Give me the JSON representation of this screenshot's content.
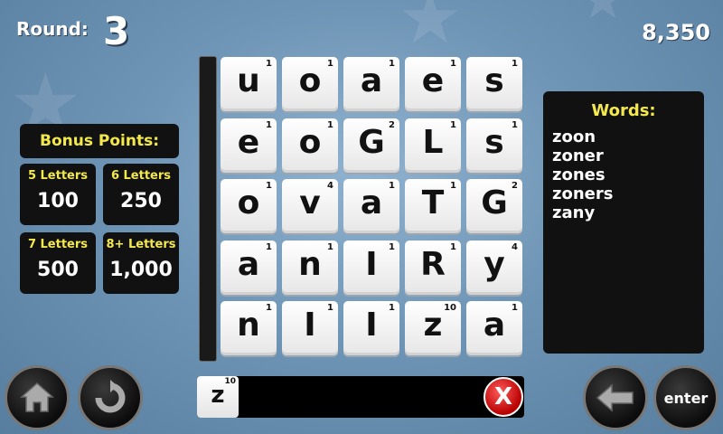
{
  "header": {
    "round_label": "Round:",
    "round_number": "3",
    "score": "8,350"
  },
  "bonus": {
    "title": "Bonus Points:",
    "tiers": [
      {
        "label": "5 Letters",
        "value": "100"
      },
      {
        "label": "6 Letters",
        "value": "250"
      },
      {
        "label": "7 Letters",
        "value": "500"
      },
      {
        "label": "8+ Letters",
        "value": "1,000"
      }
    ]
  },
  "board": {
    "rows": [
      [
        {
          "letter": "u",
          "points": "1"
        },
        {
          "letter": "o",
          "points": "1"
        },
        {
          "letter": "a",
          "points": "1"
        },
        {
          "letter": "e",
          "points": "1"
        },
        {
          "letter": "s",
          "points": "1"
        }
      ],
      [
        {
          "letter": "e",
          "points": "1"
        },
        {
          "letter": "o",
          "points": "1"
        },
        {
          "letter": "G",
          "points": "2"
        },
        {
          "letter": "L",
          "points": "1"
        },
        {
          "letter": "s",
          "points": "1"
        }
      ],
      [
        {
          "letter": "o",
          "points": "1"
        },
        {
          "letter": "v",
          "points": "4"
        },
        {
          "letter": "a",
          "points": "1"
        },
        {
          "letter": "T",
          "points": "1"
        },
        {
          "letter": "G",
          "points": "2"
        }
      ],
      [
        {
          "letter": "a",
          "points": "1"
        },
        {
          "letter": "n",
          "points": "1"
        },
        {
          "letter": "I",
          "points": "1"
        },
        {
          "letter": "R",
          "points": "1"
        },
        {
          "letter": "y",
          "points": "4"
        }
      ],
      [
        {
          "letter": "n",
          "points": "1"
        },
        {
          "letter": "I",
          "points": "1"
        },
        {
          "letter": "I",
          "points": "1"
        },
        {
          "letter": "z",
          "points": "10"
        },
        {
          "letter": "a",
          "points": "1"
        }
      ]
    ]
  },
  "words": {
    "title": "Words:",
    "list": [
      "zoon",
      "zoner",
      "zones",
      "zoners",
      "zany"
    ]
  },
  "entry": {
    "letter": "z",
    "points": "10",
    "clear_label": "X"
  },
  "controls": {
    "enter_label": "enter",
    "home_icon": "home-icon",
    "undo_icon": "undo-icon",
    "back_icon": "backspace-arrow-icon"
  }
}
